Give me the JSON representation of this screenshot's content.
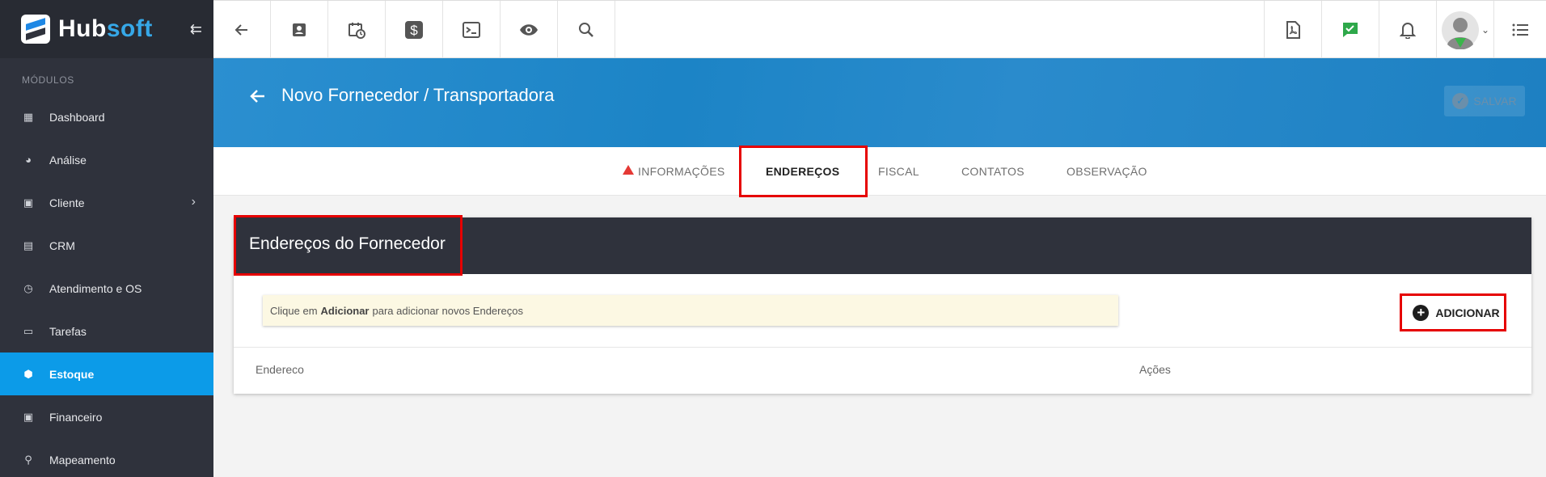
{
  "sidebar": {
    "brand_hub": "Hub",
    "brand_soft": "soft",
    "section_title": "MÓDULOS",
    "items": [
      {
        "label": "Dashboard",
        "icon": "grid-icon"
      },
      {
        "label": "Análise",
        "icon": "pie-chart-icon"
      },
      {
        "label": "Cliente",
        "icon": "contact-card-icon"
      },
      {
        "label": "CRM",
        "icon": "board-icon"
      },
      {
        "label": "Atendimento e OS",
        "icon": "calendar-clock-icon"
      },
      {
        "label": "Tarefas",
        "icon": "briefcase-icon"
      },
      {
        "label": "Estoque",
        "icon": "box-icon"
      },
      {
        "label": "Financeiro",
        "icon": "money-icon"
      },
      {
        "label": "Mapeamento",
        "icon": "map-pin-icon"
      }
    ],
    "active_item": "Estoque"
  },
  "topbar": {
    "icons": [
      "back-arrow-icon",
      "contact-icon",
      "calendar-clock-icon",
      "dollar-icon",
      "terminal-icon",
      "eye-icon",
      "search-icon"
    ],
    "right_icons": [
      "pdf-icon",
      "chat-check-icon",
      "bell-icon",
      "user-avatar",
      "list-menu-icon"
    ]
  },
  "header": {
    "title": "Novo Fornecedor / Transportadora",
    "save_label": "SALVAR"
  },
  "tabs": [
    {
      "label": "INFORMAÇÕES",
      "warning": true
    },
    {
      "label": "ENDEREÇOS",
      "active": true
    },
    {
      "label": "FISCAL"
    },
    {
      "label": "CONTATOS"
    },
    {
      "label": "OBSERVAÇÃO"
    }
  ],
  "panel": {
    "title": "Endereços do Fornecedor",
    "info_prefix": "Clique em",
    "info_bold": "Adicionar",
    "info_suffix": "para adicionar novos Endereços",
    "add_label": "ADICIONAR",
    "columns": [
      "Endereco",
      "Ações"
    ]
  },
  "colors": {
    "sidebar_bg": "#2f323c",
    "active_item": "#0c9be8",
    "header_blue": "#1c84c6",
    "highlight_red": "#e60000",
    "info_bg": "#fcf8e3"
  }
}
